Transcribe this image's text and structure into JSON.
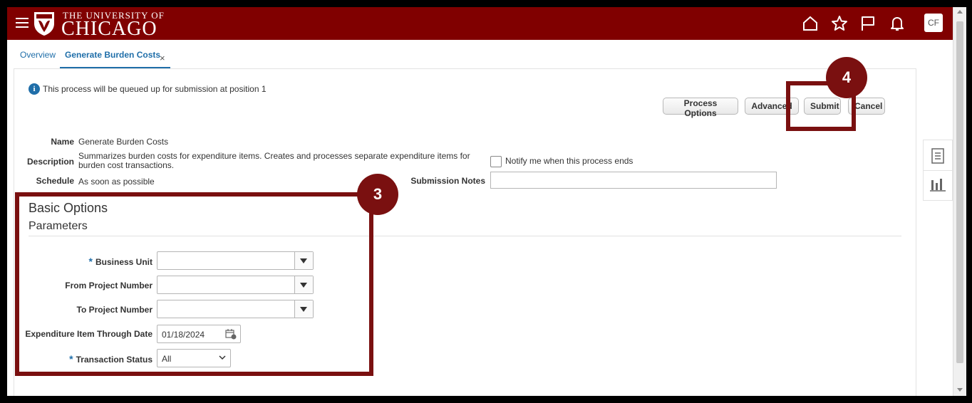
{
  "header": {
    "logo_top": "THE UNIVERSITY OF",
    "logo_bottom": "CHICAGO",
    "avatar": "CF",
    "brand_color": "#800000",
    "icons": [
      "menu-icon",
      "home-icon",
      "star-icon",
      "flag-icon",
      "bell-icon"
    ]
  },
  "tabs": {
    "overview": "Overview",
    "active": "Generate Burden Costs",
    "close": "×"
  },
  "info": {
    "icon": "i",
    "message": "This process will be queued up for submission at position 1"
  },
  "buttons": {
    "process_options": "Process Options",
    "advanced": "Advanced",
    "submit": "Submit",
    "cancel": "Cancel"
  },
  "details": {
    "name_label": "Name",
    "name_value": "Generate Burden Costs",
    "description_label": "Description",
    "description_value": "Summarizes burden costs for expenditure items. Creates and processes separate expenditure items for burden cost transactions.",
    "schedule_label": "Schedule",
    "schedule_value": "As soon as possible",
    "notify_label": "Notify me when this process ends",
    "notes_label": "Submission Notes"
  },
  "basic_options": {
    "title": "Basic Options",
    "subtitle": "Parameters",
    "required_mark": "*",
    "business_unit_label": "Business Unit",
    "from_project_label": "From Project Number",
    "to_project_label": "To Project Number",
    "exp_date_label": "Expenditure Item Through Date",
    "exp_date_value": "01/18/2024",
    "status_label": "Transaction Status",
    "status_value": "All"
  },
  "callouts": {
    "step3": "3",
    "step4": "4",
    "color": "#7a1010"
  }
}
